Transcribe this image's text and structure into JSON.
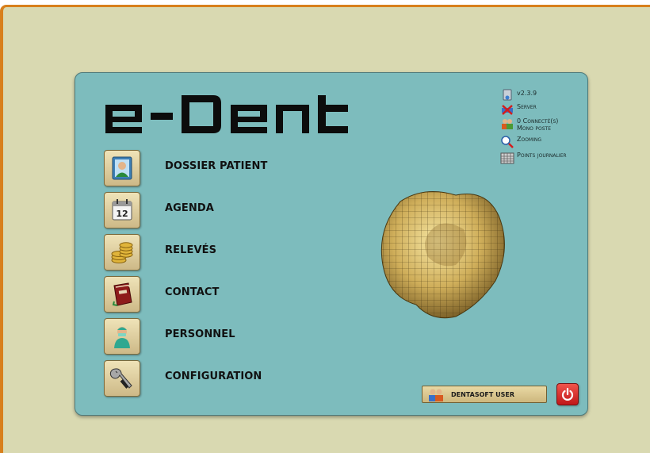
{
  "app": {
    "logo_text": "e-Dent"
  },
  "menu": [
    {
      "label": "DOSSIER PATIENT",
      "icon": "patient-folder-icon"
    },
    {
      "label": "AGENDA",
      "icon": "calendar-icon",
      "icon_text": "12"
    },
    {
      "label": "RELEVÉS",
      "icon": "coins-icon"
    },
    {
      "label": "CONTACT",
      "icon": "address-book-icon"
    },
    {
      "label": "PERSONNEL",
      "icon": "staff-icon"
    },
    {
      "label": "CONFIGURATION",
      "icon": "wrench-icon"
    }
  ],
  "status": {
    "version": "v2.3.9",
    "server": "Server",
    "connected": "0 Connecté(s)",
    "mode": "Mono poste",
    "zooming": "Zooming",
    "points": "Points journalier"
  },
  "user": {
    "label": "DENTASOFT USER"
  },
  "colors": {
    "background": "#d9d9b1",
    "border_accent": "#d8801c",
    "panel": "#7dbcbd",
    "button": "#e2d3a4",
    "power": "#d62a2a"
  }
}
